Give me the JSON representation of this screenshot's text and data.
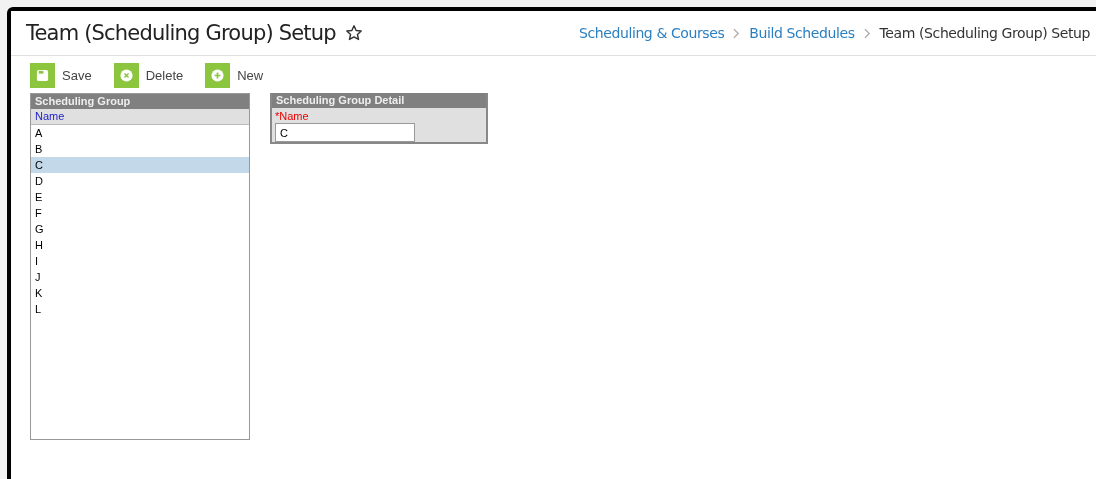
{
  "header": {
    "title": "Team (Scheduling Group) Setup",
    "breadcrumbs": [
      {
        "label": "Scheduling & Courses",
        "link": true
      },
      {
        "label": "Build Schedules",
        "link": true
      },
      {
        "label": "Team (Scheduling Group) Setup",
        "link": false
      }
    ]
  },
  "toolbar": [
    {
      "kind": "save",
      "label": "Save"
    },
    {
      "kind": "delete",
      "label": "Delete"
    },
    {
      "kind": "new",
      "label": "New"
    }
  ],
  "list_panel": {
    "title": "Scheduling Group",
    "column": "Name",
    "items": [
      {
        "label": "A",
        "selected": false
      },
      {
        "label": "B",
        "selected": false
      },
      {
        "label": "C",
        "selected": true
      },
      {
        "label": "D",
        "selected": false
      },
      {
        "label": "E",
        "selected": false
      },
      {
        "label": "F",
        "selected": false
      },
      {
        "label": "G",
        "selected": false
      },
      {
        "label": "H",
        "selected": false
      },
      {
        "label": "I",
        "selected": false
      },
      {
        "label": "J",
        "selected": false
      },
      {
        "label": "K",
        "selected": false
      },
      {
        "label": "L",
        "selected": false
      }
    ]
  },
  "detail_panel": {
    "title": "Scheduling Group Detail",
    "field_label": "*Name",
    "field_value": "C"
  }
}
